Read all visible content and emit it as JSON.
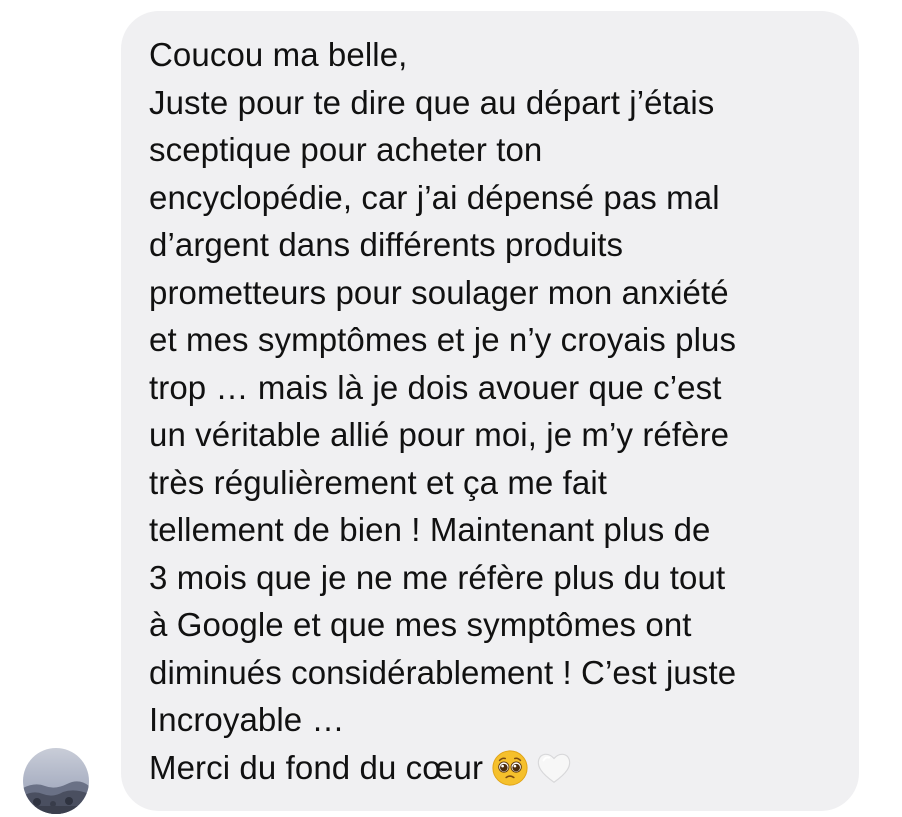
{
  "message": {
    "lines": [
      "Coucou ma belle,",
      "Juste pour te dire que au départ j’étais",
      "sceptique pour acheter ton",
      "encyclopédie, car j’ai dépensé pas mal",
      "d’argent dans différents produits",
      "prometteurs pour soulager mon anxiété",
      "et mes symptômes et je n’y croyais plus",
      "trop … mais là je dois avouer que c’est",
      "un véritable allié pour moi, je m’y réfère",
      "très régulièrement et ça me fait",
      "tellement de bien ! Maintenant plus de",
      "3 mois que je ne me réfère plus du tout",
      "à Google et que mes symptômes ont",
      "diminués considérablement ! C’est juste",
      "Incroyable …",
      "Merci du fond du cœur"
    ],
    "emojis": [
      "pleading-face",
      "white-heart"
    ]
  },
  "colors": {
    "bubble_background": "#f0f0f2",
    "text": "#111111",
    "emoji_face": "#f5c02c",
    "heart": "#f7f7f7"
  }
}
